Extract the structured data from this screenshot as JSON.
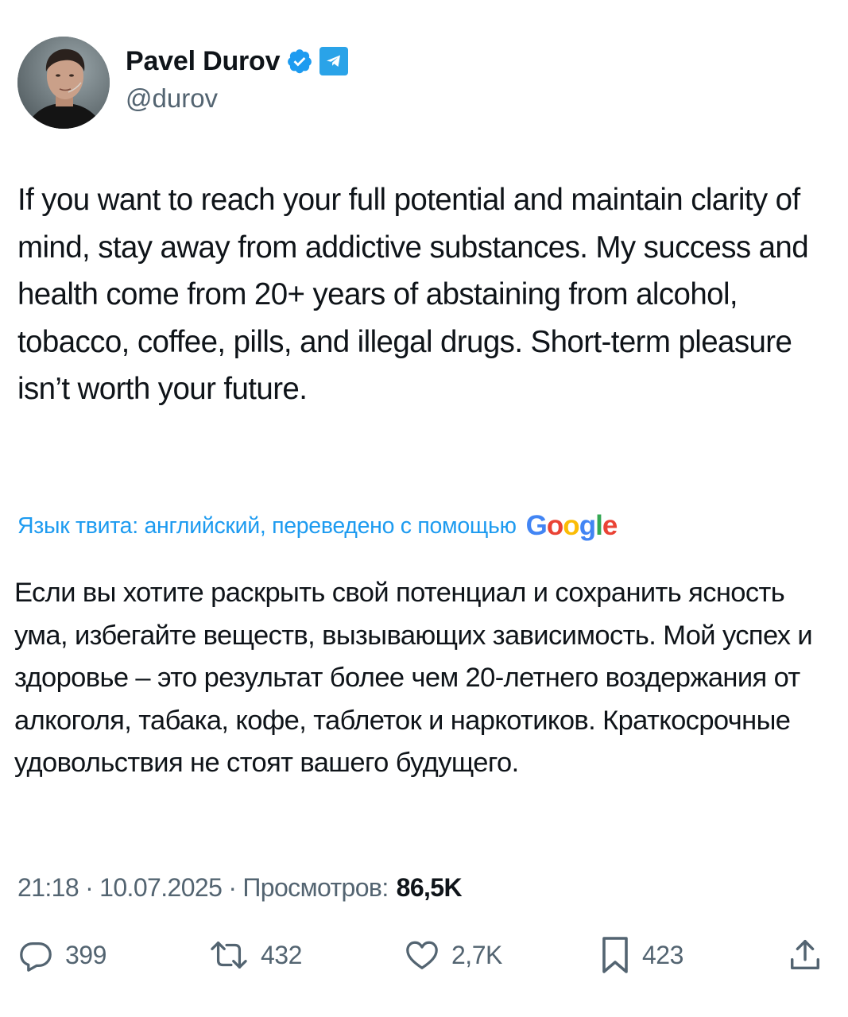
{
  "author": {
    "display_name": "Pavel Durov",
    "handle": "@durov",
    "verified_icon": "verified-badge-icon",
    "affiliate_icon": "telegram-icon"
  },
  "tweet": {
    "text": "If you want to reach your full potential and maintain clarity of mind, stay away from addictive substances. My success and health come from 20+ years of abstaining from alcohol, tobacco, coffee, pills, and illegal drugs. Short-term pleasure isn’t worth your future.",
    "translation_label": "Язык твита: английский, переведено с помощью",
    "translation_provider": "Google",
    "translated_text": "Если вы хотите раскрыть свой потенциал и сохранить ясность ума, избегайте веществ, вызывающих зависимость. Мой успех и здоровье – это результат более чем 20-летнего воздержания от алкоголя, табака, кофе, таблеток и наркотиков. Краткосрочные удовольствия не стоят вашего будущего."
  },
  "meta": {
    "time": "21:18",
    "date": "10.07.2025",
    "views_label": "Просмотров:",
    "views_count": "86,5K"
  },
  "actions": {
    "replies": "399",
    "retweets": "432",
    "likes": "2,7K",
    "bookmarks": "423"
  },
  "colors": {
    "text": "#0f1419",
    "secondary": "#536471",
    "link": "#1d9bf0",
    "verified": "#1d9bf0",
    "telegram": "#2aa3e8"
  }
}
